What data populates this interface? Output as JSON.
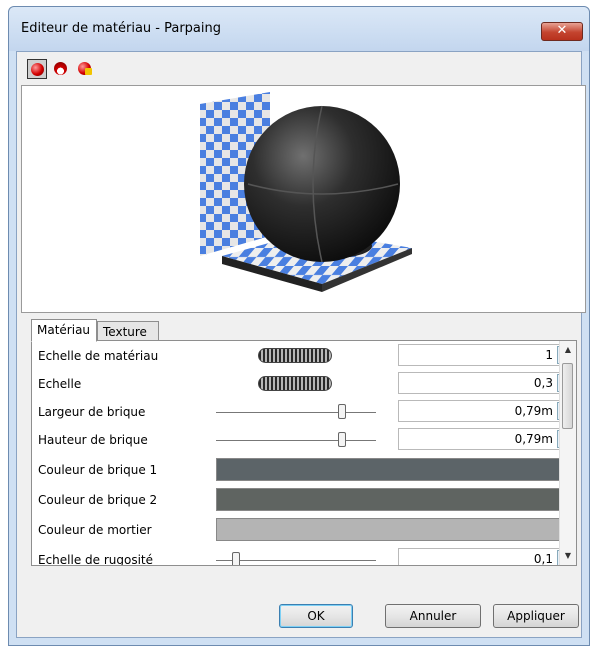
{
  "window": {
    "title": "Editeur de matériau - Parpaing",
    "close_icon": "close-icon"
  },
  "toolbar": {
    "items": [
      "sphere-preview-icon",
      "object-preview-icon",
      "render-preview-icon"
    ]
  },
  "tabs": [
    {
      "label": "Matériau"
    },
    {
      "label": "Texture"
    }
  ],
  "properties": [
    {
      "label": "Echelle de matériau",
      "control": "wheel",
      "value": "1"
    },
    {
      "label": "Echelle",
      "control": "wheel",
      "value": "0,3"
    },
    {
      "label": "Largeur de brique",
      "control": "slider",
      "level": 0.8,
      "value": "0,79m"
    },
    {
      "label": "Hauteur de brique",
      "control": "slider",
      "level": 0.8,
      "value": "0,79m"
    },
    {
      "label": "Couleur de brique 1",
      "control": "color",
      "color": "#5c6468"
    },
    {
      "label": "Couleur de brique 2",
      "control": "color",
      "color": "#5f6461"
    },
    {
      "label": "Couleur de mortier",
      "control": "color",
      "color": "#b4b4b4"
    },
    {
      "label": "Echelle de rugosité",
      "control": "slider",
      "level": 0.1,
      "value": "0,1"
    }
  ],
  "buttons": {
    "ok": "OK",
    "cancel": "Annuler",
    "apply": "Appliquer"
  },
  "colors": {
    "accent": "#3c7fb1",
    "checker_blue": "#4a7fe0"
  }
}
